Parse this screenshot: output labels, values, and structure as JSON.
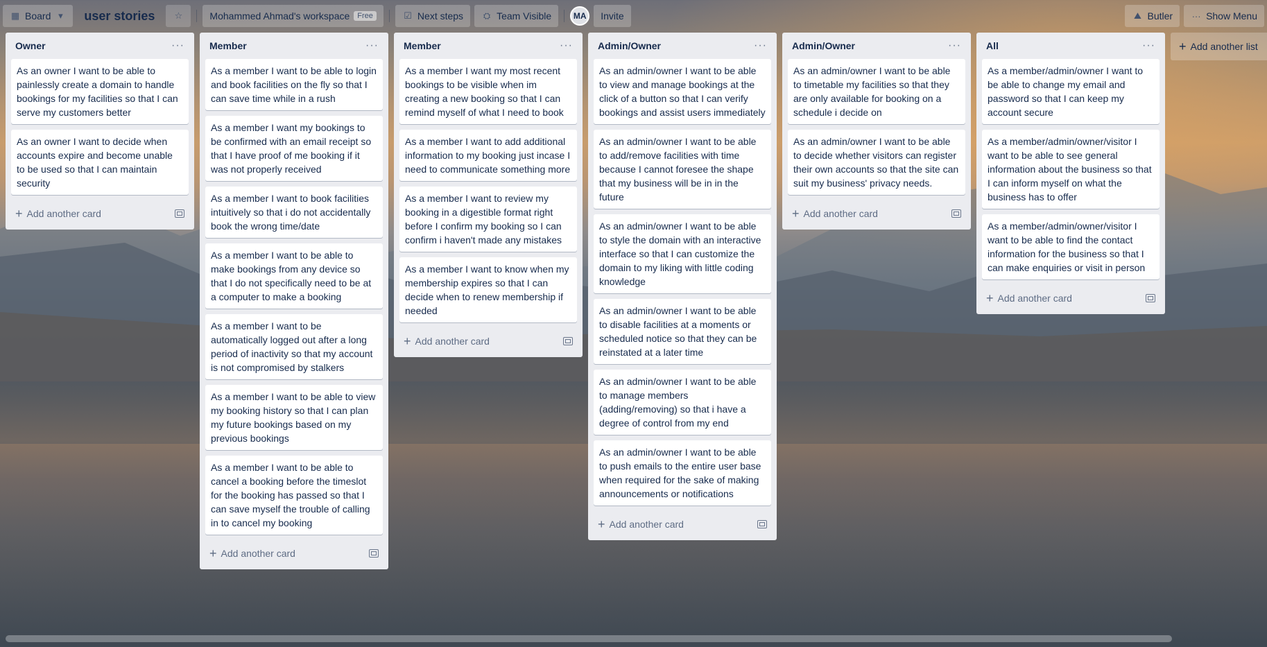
{
  "header": {
    "board_switch_label": "Board",
    "board_title": "user stories",
    "workspace_label": "Mohammed Ahmad's workspace",
    "workspace_badge": "Free",
    "next_steps_label": "Next steps",
    "visibility_label": "Team Visible",
    "avatar_initials": "MA",
    "invite_label": "Invite",
    "butler_label": "Butler",
    "show_menu_label": "Show Menu"
  },
  "lists": [
    {
      "title": "Owner",
      "cards": [
        "As an owner I want to be able to painlessly create a domain to handle bookings for my facilities so that I can serve my customers better",
        "As an owner I want to decide when accounts expire and become unable to be used so that I can maintain security"
      ]
    },
    {
      "title": "Member",
      "cards": [
        "As a member I want to be able to login and book facilities on the fly so that I can save time while in a rush",
        "As a member I want my bookings to be confirmed with an email receipt so that I have proof of me booking if it was not properly received",
        "As a member I want to book facilities intuitively so that i do not accidentally book the wrong time/date",
        "As a member I want to be able to make bookings from any device so that I do not specifically need to be at a computer to make a booking",
        "As a member I want to be automatically logged out after a long period of inactivity so that my account is not compromised by stalkers",
        "As a member I want to be able to view my booking history so that I can plan my future bookings based on my previous bookings",
        "As a member I want to be able to cancel a booking before the timeslot for the booking has passed so that I can save myself the trouble of calling in to cancel my booking"
      ]
    },
    {
      "title": "Member",
      "cards": [
        "As a member I want my most recent bookings to be visible when im creating a new booking so that I can remind myself of what I need to book",
        "As a member I want to add additional information to my booking just incase I need to communicate something more",
        "As a member I want to review my booking in a digestible format right before I confirm my booking so I can confirm i haven't made any mistakes",
        "As a member I want to know when my membership expires so that I can decide when to renew membership if needed"
      ]
    },
    {
      "title": "Admin/Owner",
      "cards": [
        "As an admin/owner I want to be able to view and manage bookings at the click of a button so that I can verify bookings and assist users immediately",
        "As an admin/owner I want to be able to add/remove facilities with time because I cannot foresee the shape that my business will be in in the future",
        "As an admin/owner I want to be able to style the domain with an interactive interface so that I can customize the domain to my liking with little coding knowledge",
        "As an admin/owner I want to be able to disable facilities at a moments or scheduled notice so that they can be reinstated at a later time",
        "As an admin/owner I want to be able to manage members (adding/removing) so that i have a degree of control from my end",
        "As an admin/owner I want to be able to push emails to the entire user base when required for the sake of making announcements or notifications"
      ]
    },
    {
      "title": "Admin/Owner",
      "cards": [
        "As an admin/owner I want to be able to timetable my facilities so that they are only available for booking on a schedule i decide on",
        "As an admin/owner I want to be able to decide whether visitors can register their own accounts so that the site can suit my business' privacy needs."
      ]
    },
    {
      "title": "All",
      "cards": [
        "As a member/admin/owner I want to be able to change my email and password so that I can keep my account secure",
        "As a member/admin/owner/visitor I want to be able to see general information about the business so that I can inform myself on what the business has to offer",
        "As a member/admin/owner/visitor I want to be able to find the contact information for the business so that I can make enquiries or visit in person"
      ]
    }
  ],
  "list_menu_glyph": "···",
  "add_card_label": "Add another card",
  "add_list_label": "Add another list"
}
